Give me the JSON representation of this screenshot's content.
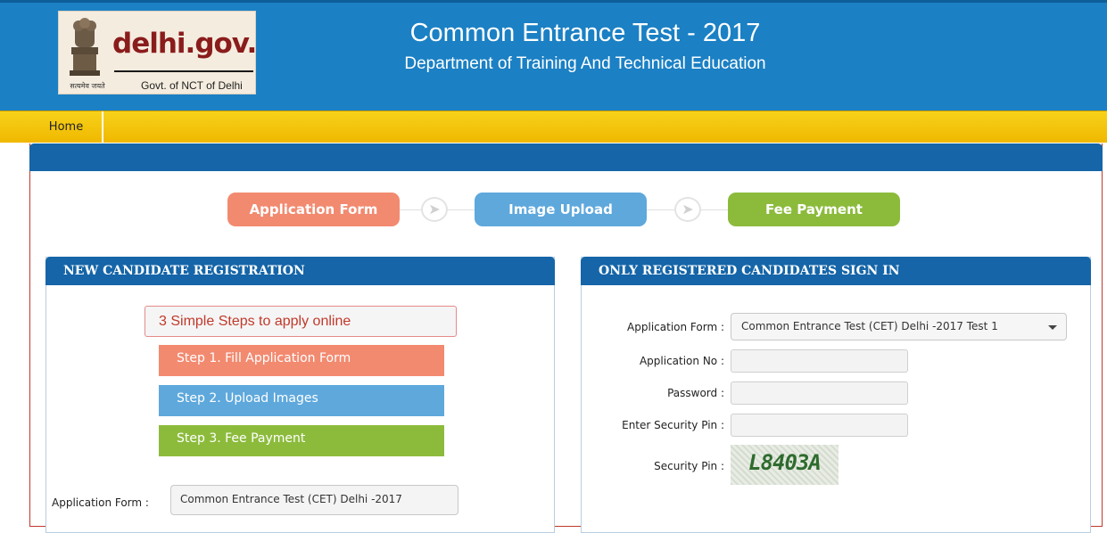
{
  "header": {
    "logo_domain": "delhi.gov.in",
    "logo_subtitle": "Govt. of NCT of Delhi",
    "logo_motto": "सत्यमेव जयते",
    "title": "Common Entrance Test - 2017",
    "subtitle": "Department of Training And Technical Education"
  },
  "nav": {
    "home": "Home"
  },
  "process_steps": {
    "application_form": "Application Form",
    "image_upload": "Image Upload",
    "fee_payment": "Fee Payment"
  },
  "new_registration": {
    "heading": "NEW CANDIDATE REGISTRATION",
    "steps_title": "3 Simple Steps to apply online",
    "step1": "Step 1. Fill Application Form",
    "step2": "Step 2. Upload Images",
    "step3": "Step 3. Fee Payment",
    "form_label": "Application Form :",
    "form_select_value": "Common Entrance Test (CET) Delhi -2017"
  },
  "sign_in": {
    "heading": "ONLY REGISTERED CANDIDATES SIGN IN",
    "application_form_label": "Application Form :",
    "application_form_value": "Common Entrance Test (CET) Delhi -2017 Test 1",
    "application_no_label": "Application No :",
    "application_no_value": "",
    "password_label": "Password :",
    "password_value": "",
    "security_pin_input_label": "Enter Security Pin :",
    "security_pin_input_value": "",
    "security_pin_label": "Security Pin :",
    "captcha_text": "L8403A"
  },
  "colors": {
    "header_blue": "#1b80c4",
    "nav_yellow": "#f7d21a",
    "panel_blue": "#1565a8",
    "step_orange": "#f28a70",
    "step_blue": "#5ea8dc",
    "step_green": "#8cbb3c"
  }
}
